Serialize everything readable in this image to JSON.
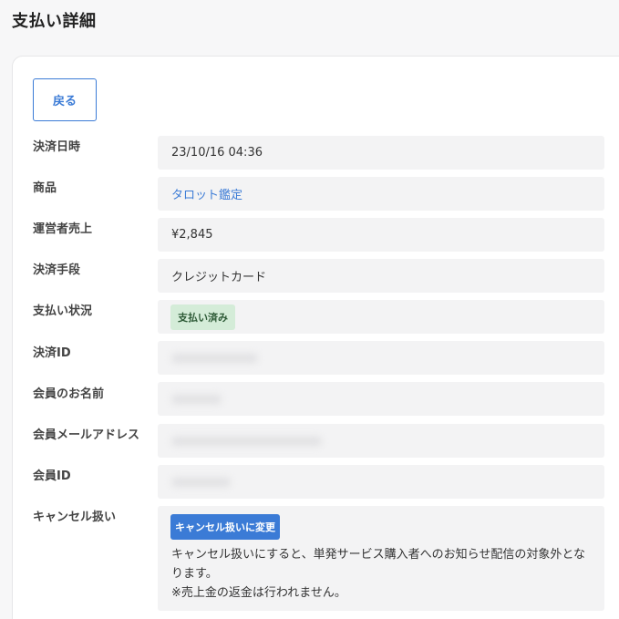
{
  "page_title": "支払い詳細",
  "back_label": "戻る",
  "rows": [
    {
      "label": "決済日時",
      "value": "23/10/16 04:36"
    },
    {
      "label": "商品",
      "value": "タロット鑑定"
    },
    {
      "label": "運営者売上",
      "value": "¥2,845"
    },
    {
      "label": "決済手段",
      "value": "クレジットカード"
    },
    {
      "label": "支払い状況",
      "value": "支払い済み"
    },
    {
      "label": "決済ID",
      "value": ""
    },
    {
      "label": "会員のお名前",
      "value": ""
    },
    {
      "label": "会員メールアドレス",
      "value": ""
    },
    {
      "label": "会員ID",
      "value": ""
    },
    {
      "label": "キャンセル扱い",
      "value": ""
    }
  ],
  "cancel": {
    "button_label": "キャンセル扱いに変更",
    "note_line1": "キャンセル扱いにすると、単発サービス購入者へのお知らせ配信の対象外となります。",
    "note_line2": "※売上金の返金は行われません。"
  },
  "colors": {
    "accent": "#3b7bd6",
    "paid_badge_bg": "#d4ecd8",
    "value_bg": "#f3f3f4"
  }
}
